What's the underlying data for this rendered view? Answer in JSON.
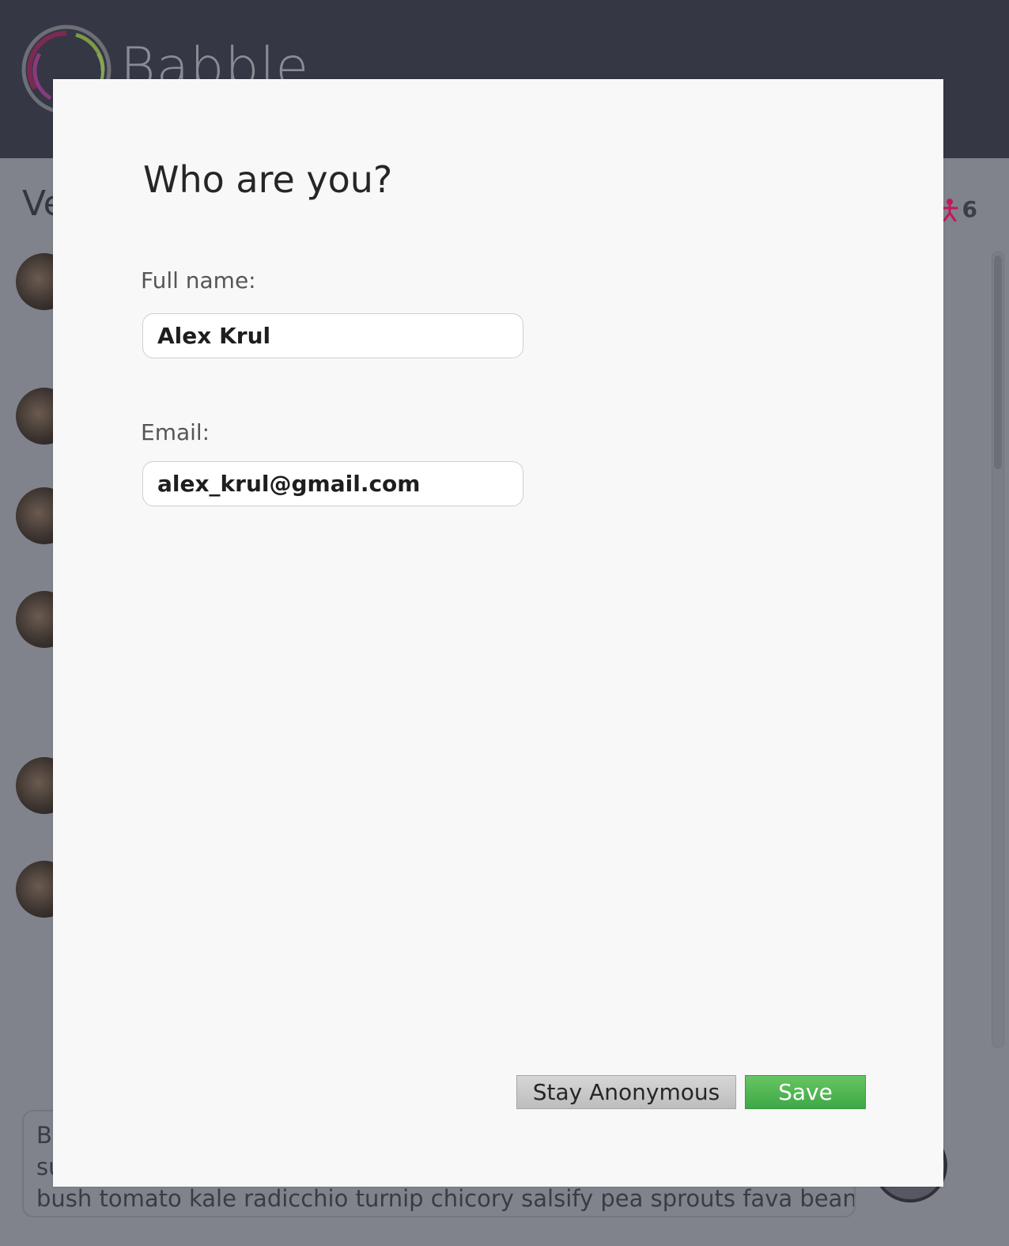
{
  "app": {
    "logo_text": "Babble"
  },
  "room": {
    "title": "Ve",
    "user_count": "6"
  },
  "composer": {
    "lines": [
      "B",
      "su",
      "bush tomato kale radicchio turnip chicory salsify pea sprouts fava bean."
    ]
  },
  "modal": {
    "title": "Who are you?",
    "full_name_label": "Full name:",
    "full_name_value": "Alex Krul",
    "email_label": "Email:",
    "email_value": "alex_krul@gmail.com",
    "stay_anonymous_label": "Stay Anonymous",
    "save_label": "Save"
  },
  "colors": {
    "header_bg": "#353744",
    "overlay_bg": "#80838b",
    "modal_bg": "#f8f8f8",
    "save_green": "#4cb44f",
    "person_icon": "#c2185b"
  }
}
